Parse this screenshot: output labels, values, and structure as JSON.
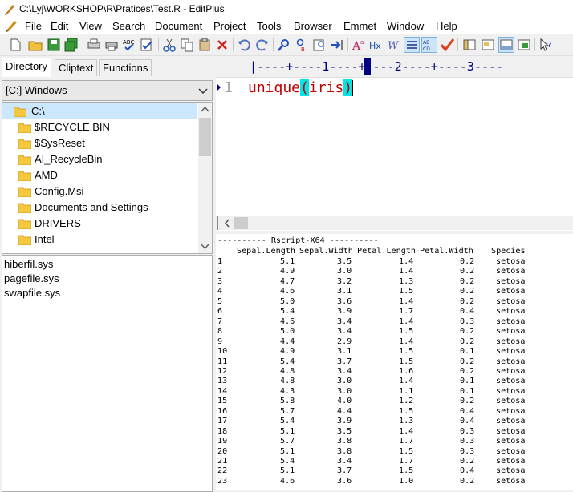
{
  "window": {
    "title": "C:\\Lyj\\WORKSHOP\\R\\Pratices\\Test.R - EditPlus"
  },
  "menu": [
    "File",
    "Edit",
    "View",
    "Search",
    "Document",
    "Project",
    "Tools",
    "Browser",
    "Emmet",
    "Window",
    "Help"
  ],
  "left_panel": {
    "tabs": [
      "Directory",
      "Cliptext",
      "Functions"
    ],
    "active_tab": "Directory",
    "drive": "[C:] Windows",
    "folders": [
      "C:\\",
      "$RECYCLE.BIN",
      "$SysReset",
      "AI_RecycleBin",
      "AMD",
      "Config.Msi",
      "Documents and Settings",
      "DRIVERS",
      "Intel"
    ],
    "files": [
      "hiberfil.sys",
      "pagefile.sys",
      "swapfile.sys"
    ]
  },
  "editor": {
    "ruler": "|----+----1----+----2----+----3----",
    "lines": [
      {
        "number": "1",
        "fn": "unique",
        "open": "(",
        "arg": "iris",
        "close": ")"
      }
    ]
  },
  "output": {
    "banner": "---------- Rscript-X64 ----------",
    "columns": [
      "Sepal.Length",
      "Sepal.Width",
      "Petal.Length",
      "Petal.Width",
      "Species"
    ],
    "rows": [
      [
        "1",
        "5.1",
        "3.5",
        "1.4",
        "0.2",
        "setosa"
      ],
      [
        "2",
        "4.9",
        "3.0",
        "1.4",
        "0.2",
        "setosa"
      ],
      [
        "3",
        "4.7",
        "3.2",
        "1.3",
        "0.2",
        "setosa"
      ],
      [
        "4",
        "4.6",
        "3.1",
        "1.5",
        "0.2",
        "setosa"
      ],
      [
        "5",
        "5.0",
        "3.6",
        "1.4",
        "0.2",
        "setosa"
      ],
      [
        "6",
        "5.4",
        "3.9",
        "1.7",
        "0.4",
        "setosa"
      ],
      [
        "7",
        "4.6",
        "3.4",
        "1.4",
        "0.3",
        "setosa"
      ],
      [
        "8",
        "5.0",
        "3.4",
        "1.5",
        "0.2",
        "setosa"
      ],
      [
        "9",
        "4.4",
        "2.9",
        "1.4",
        "0.2",
        "setosa"
      ],
      [
        "10",
        "4.9",
        "3.1",
        "1.5",
        "0.1",
        "setosa"
      ],
      [
        "11",
        "5.4",
        "3.7",
        "1.5",
        "0.2",
        "setosa"
      ],
      [
        "12",
        "4.8",
        "3.4",
        "1.6",
        "0.2",
        "setosa"
      ],
      [
        "13",
        "4.8",
        "3.0",
        "1.4",
        "0.1",
        "setosa"
      ],
      [
        "14",
        "4.3",
        "3.0",
        "1.1",
        "0.1",
        "setosa"
      ],
      [
        "15",
        "5.8",
        "4.0",
        "1.2",
        "0.2",
        "setosa"
      ],
      [
        "16",
        "5.7",
        "4.4",
        "1.5",
        "0.4",
        "setosa"
      ],
      [
        "17",
        "5.4",
        "3.9",
        "1.3",
        "0.4",
        "setosa"
      ],
      [
        "18",
        "5.1",
        "3.5",
        "1.4",
        "0.3",
        "setosa"
      ],
      [
        "19",
        "5.7",
        "3.8",
        "1.7",
        "0.3",
        "setosa"
      ],
      [
        "20",
        "5.1",
        "3.8",
        "1.5",
        "0.3",
        "setosa"
      ],
      [
        "21",
        "5.4",
        "3.4",
        "1.7",
        "0.2",
        "setosa"
      ],
      [
        "22",
        "5.1",
        "3.7",
        "1.5",
        "0.4",
        "setosa"
      ],
      [
        "23",
        "4.6",
        "3.6",
        "1.0",
        "0.2",
        "setosa"
      ]
    ]
  },
  "toolbar": [
    "new-icon",
    "open-icon",
    "save-icon",
    "save-all-icon",
    "print-preview-icon",
    "print-icon",
    "spell-check-icon",
    "spell-check-all-icon",
    "cut-icon",
    "copy-icon",
    "paste-icon",
    "delete-icon",
    "undo-icon",
    "redo-icon",
    "find-icon",
    "replace-icon",
    "find-in-files-icon",
    "goto-icon",
    "font-size-icon",
    "hex-icon",
    "word-wrap-icon",
    "line-number-icon",
    "ruler-icon",
    "check-icon",
    "directory-window-icon",
    "output-window-icon",
    "cliptext-window-icon",
    "fullscreen-icon",
    "help-icon"
  ],
  "colors": {
    "accent": "#000080",
    "keyword": "#c00000",
    "paren_highlight": "#00e5e5",
    "selection": "#cce8ff"
  }
}
